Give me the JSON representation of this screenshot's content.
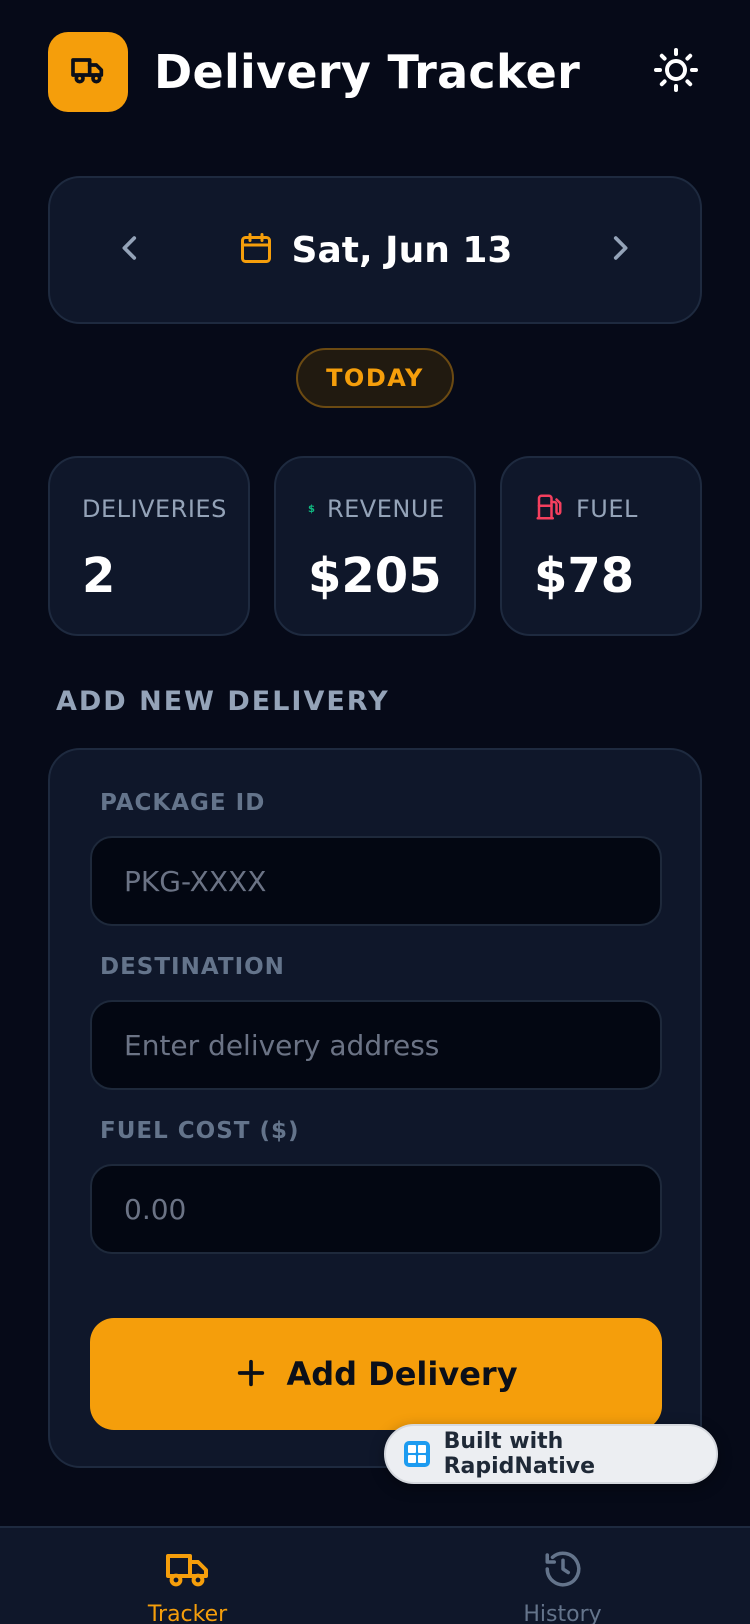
{
  "header": {
    "title": "Delivery Tracker",
    "logo_icon": "truck-icon",
    "theme_icon": "sun-icon"
  },
  "date_nav": {
    "prev_icon": "chevron-left-icon",
    "next_icon": "chevron-right-icon",
    "calendar_icon": "calendar-icon",
    "date_label": "Sat, Jun 13",
    "badge": "TODAY"
  },
  "stats": [
    {
      "label": "DELIVERIES",
      "value": "2",
      "icon": "none"
    },
    {
      "label": "REVENUE",
      "value": "$205",
      "icon": "dollar-icon",
      "icon_color": "#10b981",
      "icon_text": "$"
    },
    {
      "label": "FUEL",
      "value": "$78",
      "icon": "fuel-pump-icon",
      "icon_color": "#f43f5e"
    }
  ],
  "form": {
    "section_title": "ADD NEW DELIVERY",
    "package_label": "PACKAGE ID",
    "package_placeholder": "PKG-XXXX",
    "destination_label": "DESTINATION",
    "destination_placeholder": "Enter delivery address",
    "fuel_label": "FUEL COST ($)",
    "fuel_placeholder": "0.00",
    "submit_label": "Add Delivery",
    "submit_icon": "plus-icon"
  },
  "built_badge": {
    "label": "Built with RapidNative"
  },
  "tabs": [
    {
      "label": "Tracker",
      "icon": "truck-icon",
      "active": true
    },
    {
      "label": "History",
      "icon": "history-icon",
      "active": false
    }
  ],
  "colors": {
    "accent": "#f59e0b",
    "background": "#060a18",
    "card": "#0f172a",
    "revenue": "#10b981",
    "fuel": "#f43f5e"
  }
}
